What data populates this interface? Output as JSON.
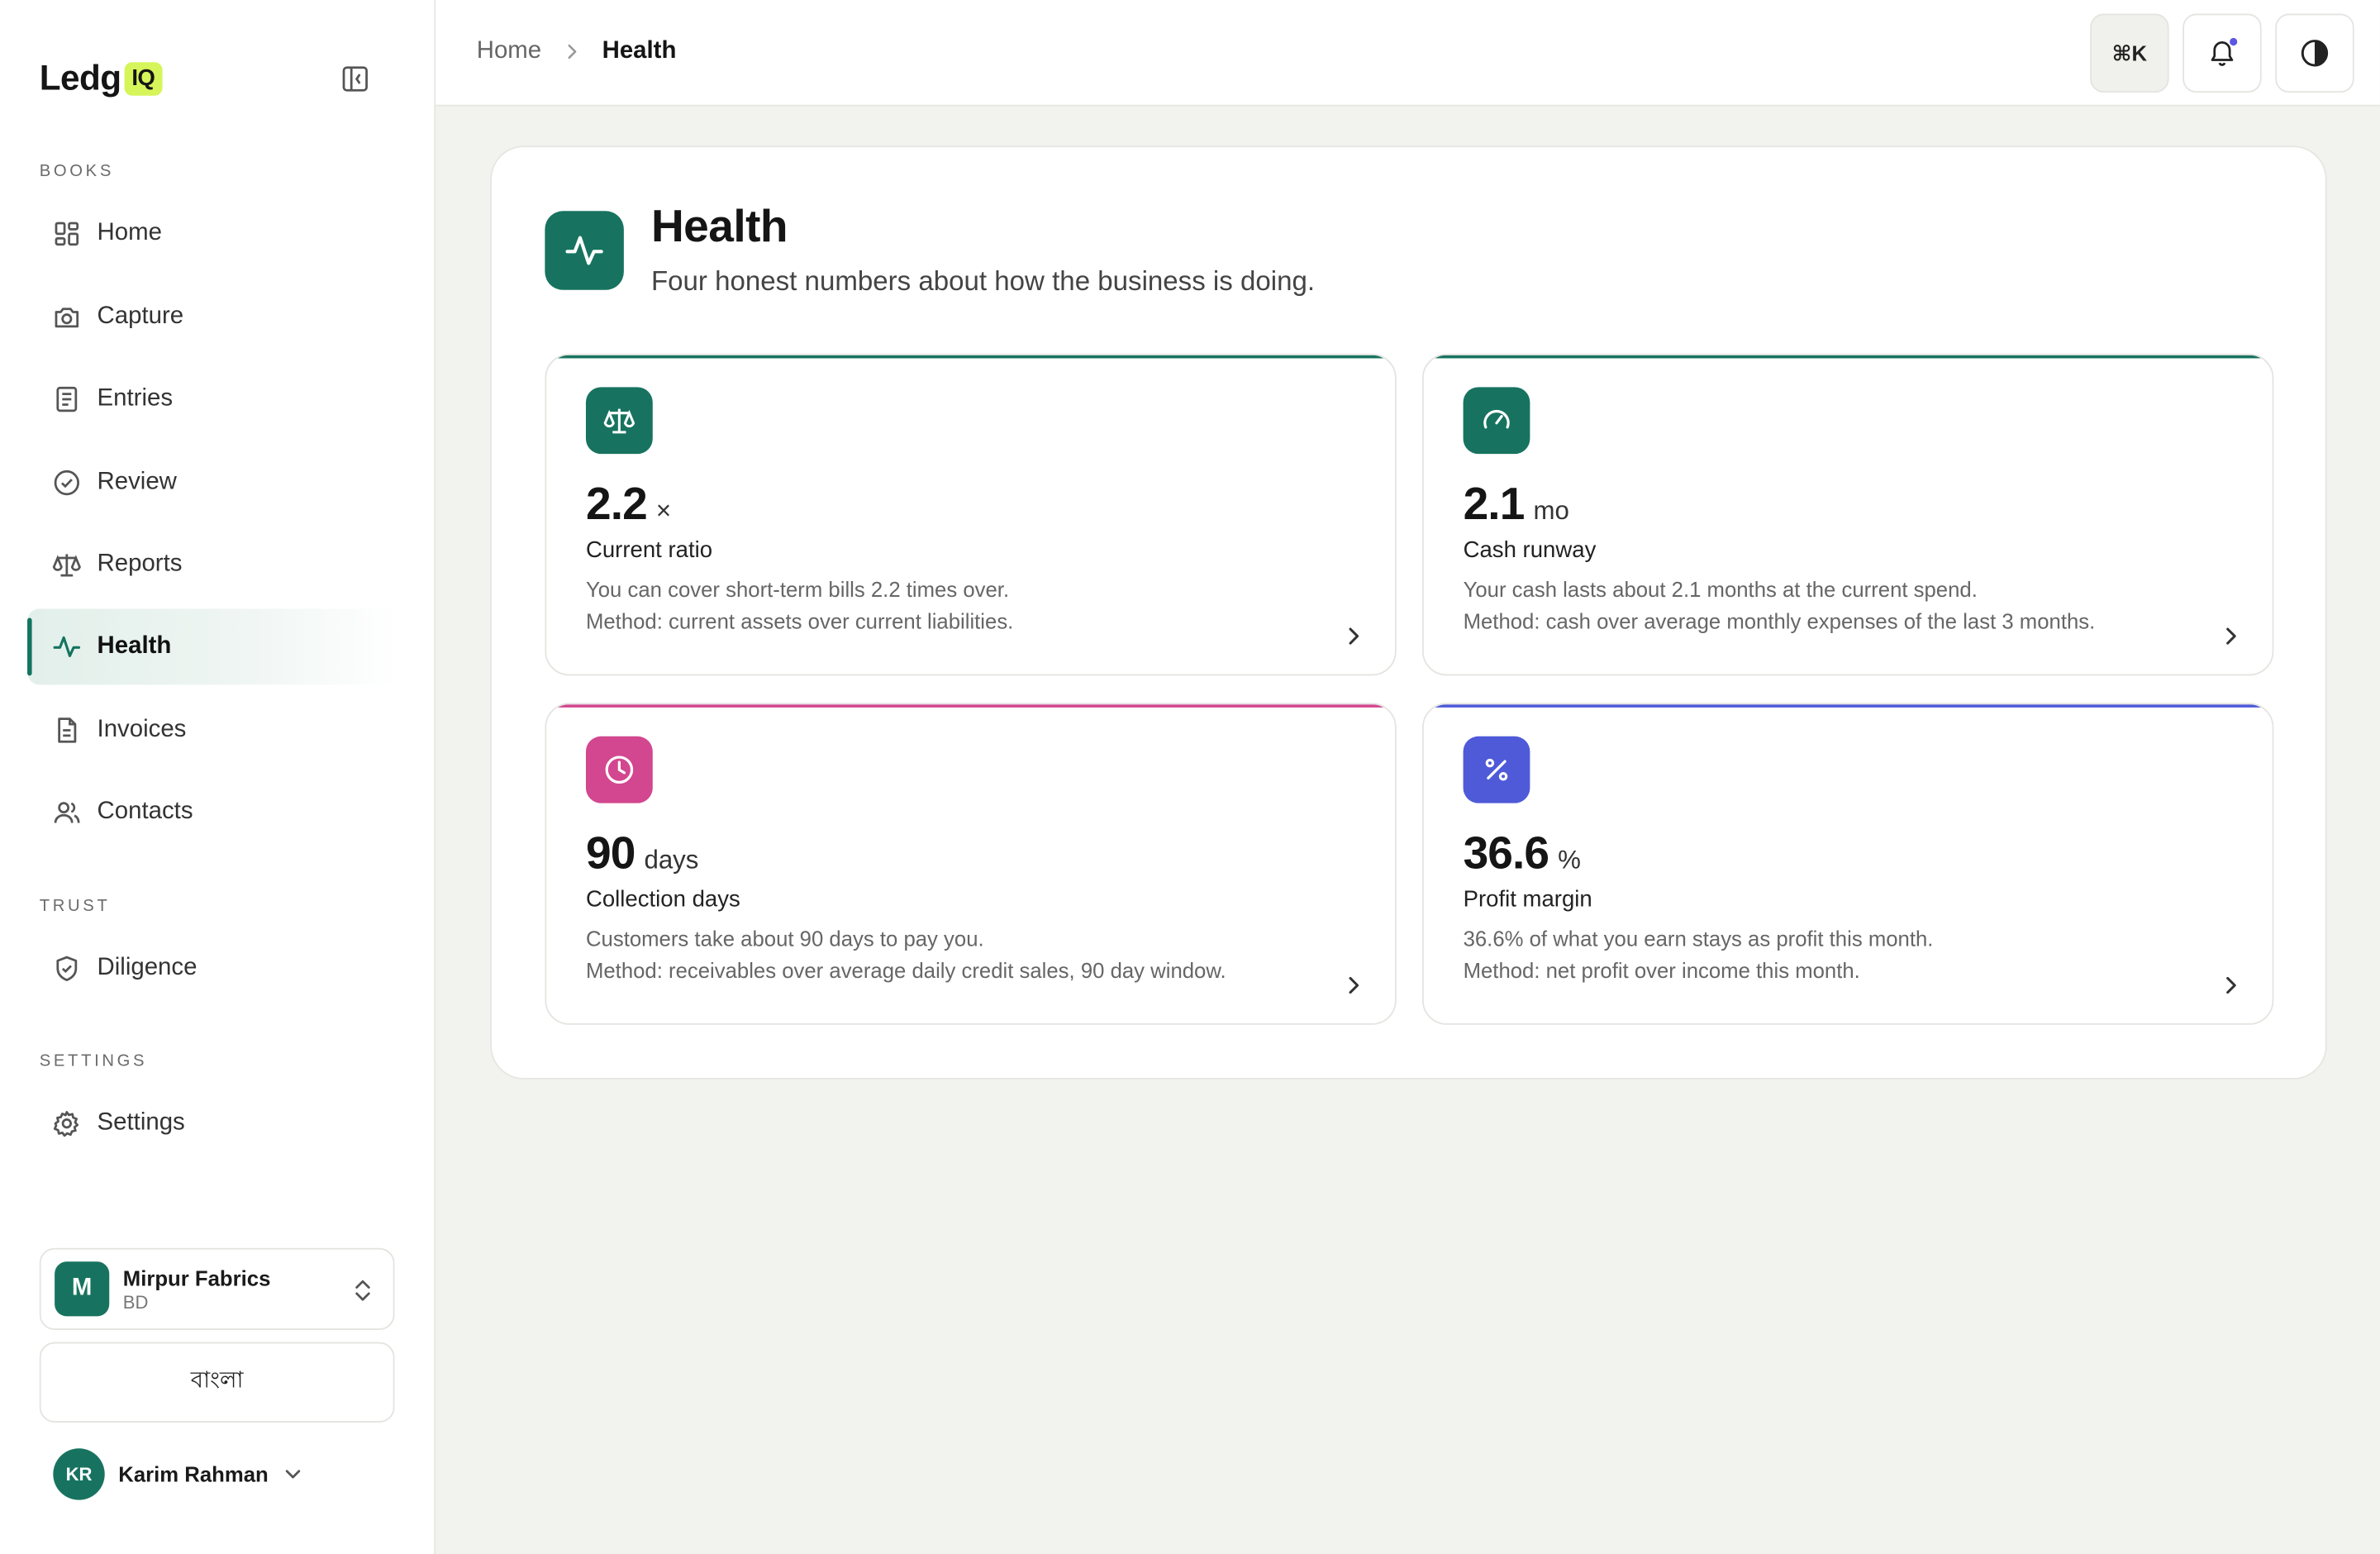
{
  "app": {
    "logo_text": "Ledg",
    "logo_badge": "IQ"
  },
  "sidebar": {
    "sections": {
      "books": "BOOKS",
      "trust": "TRUST",
      "settings": "SETTINGS"
    },
    "items": [
      {
        "label": "Home",
        "icon": "grid-icon"
      },
      {
        "label": "Capture",
        "icon": "camera-icon"
      },
      {
        "label": "Entries",
        "icon": "receipt-icon"
      },
      {
        "label": "Review",
        "icon": "check-circle-icon"
      },
      {
        "label": "Reports",
        "icon": "scale-icon"
      },
      {
        "label": "Health",
        "icon": "activity-icon",
        "active": true
      },
      {
        "label": "Invoices",
        "icon": "document-icon"
      },
      {
        "label": "Contacts",
        "icon": "users-icon"
      },
      {
        "label": "Diligence",
        "icon": "shield-check-icon"
      },
      {
        "label": "Settings",
        "icon": "gear-icon"
      }
    ],
    "org": {
      "initial": "M",
      "name": "Mirpur Fabrics",
      "country": "BD"
    },
    "language_button": "বাংলা",
    "user": {
      "initials": "KR",
      "name": "Karim Rahman"
    }
  },
  "topbar": {
    "breadcrumb_home": "Home",
    "breadcrumb_current": "Health",
    "command_shortcut": "⌘K"
  },
  "page": {
    "title": "Health",
    "subtitle": "Four honest numbers about how the business is doing."
  },
  "metrics": [
    {
      "value": "2.2",
      "unit": "×",
      "name": "Current ratio",
      "line1": "You can cover short-term bills 2.2 times over.",
      "line2": "Method: current assets over current liabilities.",
      "color": "#17735f",
      "icon": "scale-icon"
    },
    {
      "value": "2.1",
      "unit": "mo",
      "name": "Cash runway",
      "line1": "Your cash lasts about 2.1 months at the current spend.",
      "line2": "Method: cash over average monthly expenses of the last 3 months.",
      "color": "#17735f",
      "icon": "gauge-icon"
    },
    {
      "value": "90",
      "unit": "days",
      "name": "Collection days",
      "line1": "Customers take about 90 days to pay you.",
      "line2": "Method: receivables over average daily credit sales, 90 day window.",
      "color": "#d2478f",
      "icon": "clock-icon"
    },
    {
      "value": "36.6",
      "unit": "%",
      "name": "Profit margin",
      "line1": "36.6% of what you earn stays as profit this month.",
      "line2": "Method: net profit over income this month.",
      "color": "#4f5ad9",
      "icon": "percent-icon"
    }
  ]
}
